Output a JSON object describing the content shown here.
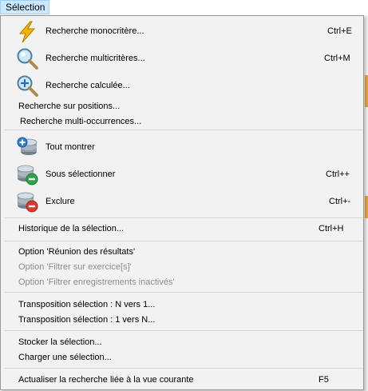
{
  "menubar": {
    "title": "Sélection"
  },
  "menu": {
    "search_mono": {
      "label": "Recherche monocritère...",
      "shortcut": "Ctrl+E",
      "icon": "lightning-icon"
    },
    "search_multi": {
      "label": "Recherche multicritères...",
      "shortcut": "Ctrl+M",
      "icon": "magnifier-icon"
    },
    "search_calc": {
      "label": "Recherche calculée...",
      "icon": "magnifier-plus-icon"
    },
    "search_positions": {
      "label": "Recherche sur positions..."
    },
    "search_multi_occ": {
      "label": "Recherche multi-occurrences..."
    },
    "show_all": {
      "label": "Tout montrer",
      "icon": "database-add-icon"
    },
    "subselect": {
      "label": "Sous sélectionner",
      "shortcut": "Ctrl++",
      "icon": "database-minus-green-icon"
    },
    "exclude": {
      "label": "Exclure",
      "shortcut": "Ctrl+-",
      "icon": "database-minus-red-icon"
    },
    "history": {
      "label": "Historique de la sélection...",
      "shortcut": "Ctrl+H"
    },
    "option_union": {
      "label": "Option 'Réunion des résultats'"
    },
    "option_exercise": {
      "label": "Option 'Filtrer sur exercice[s]'"
    },
    "option_inactive": {
      "label": "Option 'Filtrer enregistrements inactivés'"
    },
    "transpose_n1": {
      "label": "Transposition sélection : N vers 1..."
    },
    "transpose_1n": {
      "label": "Transposition sélection : 1 vers N..."
    },
    "store": {
      "label": "Stocker la sélection..."
    },
    "load": {
      "label": "Charger une sélection..."
    },
    "refresh": {
      "label": "Actualiser la recherche liée à la vue courante",
      "shortcut": "F5"
    }
  },
  "colors": {
    "menu_bg": "#f2f2f2",
    "menu_title_highlight": "#cce8ff",
    "disabled_text": "#8d8d8d",
    "separator": "#d7d7d7"
  }
}
